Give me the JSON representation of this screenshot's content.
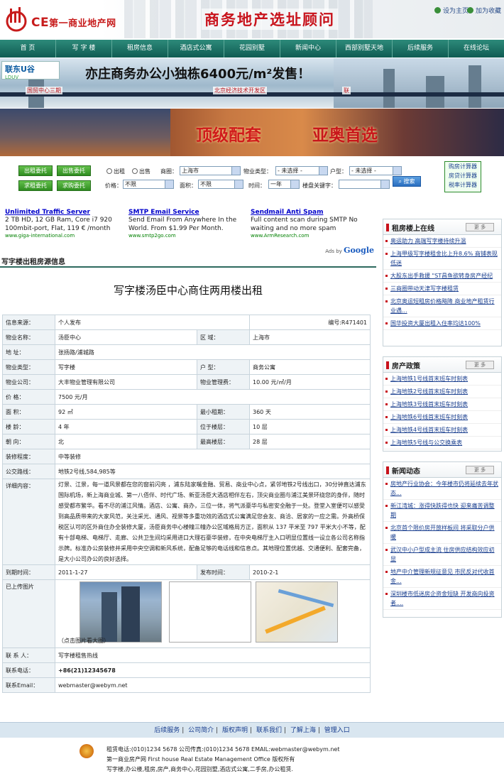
{
  "header": {
    "logo": "CE",
    "logo_text": "第一商业地产网",
    "slogan": "商务地产选址顾问",
    "set_home": "设为主页",
    "add_fav": "加为收藏"
  },
  "nav": [
    "首 页",
    "写 字 楼",
    "租房信息",
    "酒店式公寓",
    "花园别墅",
    "新闻中心",
    "西部别墅天地",
    "后续服务",
    "在线论坛"
  ],
  "banner1": {
    "brand": "联东U谷",
    "brand_sub": "LDUV",
    "headline": "亦庄商务办公小独栋6400元/m²发售！",
    "left_tag": "国贸中心三期",
    "mid_tag": "北京经济技术开发区",
    "right_tag": "联"
  },
  "banner2": {
    "t1": "顶级配套",
    "t2": "亚奥首选"
  },
  "search": {
    "btns": [
      "出租委托",
      "出售委托",
      "求租委托",
      "求购委托"
    ],
    "radio1": "出租",
    "radio2": "出售",
    "shangquan_label": "商圈：",
    "shangquan": "上海市",
    "wuye_label": "物业类型：",
    "wuye": "- 未选择 -",
    "huxing_label": "户型：",
    "huxing": "- 未选择 -",
    "price_label": "价格：",
    "price": "不限",
    "area_label": "面积：",
    "area": "不限",
    "time_label": "时间：",
    "time": "一年",
    "kw_label": "楼盘关键字：",
    "submit": "搜索"
  },
  "calc": [
    "购房计算器",
    "房贷计算器",
    "税率计算器"
  ],
  "ads": [
    {
      "title": "Unlimited Traffic Server",
      "desc": "2 TB HD, 12 GB Ram, Core i7 920 100mbit-port, Flat, 119 € /month",
      "url": "www.giga-international.com"
    },
    {
      "title": "SMTP Email Service",
      "desc": "Send Email From Anywhere In the World. From $1.99 Per Month.",
      "url": "www.smtp2go.com"
    },
    {
      "title": "Sendmail Anti Spam",
      "desc": "Full content scan during SMTP No waiting and no more spam",
      "url": "www.ArmResearch.com"
    }
  ],
  "ads_by": "Ads by",
  "google": "Google",
  "section_title": "写字楼出租房源信息",
  "listing_title": "写字楼汤臣中心商住两用楼出租",
  "table": {
    "source_l": "信息来源：",
    "source": "个人发布",
    "code": "编号:R471401",
    "name_l": "物业名称：",
    "name": "汤臣中心",
    "district_l": "区 域：",
    "district": "上海市",
    "addr_l": "地 址：",
    "addr": "张扬路/浦城路",
    "type_l": "物业类型：",
    "type": "写字楼",
    "huxing_l": "户 型：",
    "huxing": "商务公寓",
    "company_l": "物业公司：",
    "company": "大丰物业管理有限公司",
    "fee_l": "物业管理费：",
    "fee": "10.00 元/㎡/月",
    "price_l": "价 格：",
    "price": "7500 元/月",
    "area_l": "面 积：",
    "area": "92 ㎡",
    "minlease_l": "最小租期：",
    "minlease": "360 天",
    "age_l": "楼 龄：",
    "age": "4 年",
    "floor_l": "位于楼层：",
    "floor": "10 层",
    "face_l": "朝 向：",
    "face": "北",
    "top_l": "最高楼层：",
    "top": "28 层",
    "deco_l": "装修程度：",
    "deco": "中等装修",
    "bus_l": "公交路线：",
    "bus": "地铁2号线,584,985等",
    "detail_l": "详细内容：",
    "detail": "灯景、江景，每一道风景都在您的窗前闪亮 ，浦东陆家嘴金融、贸易、商业中心点，紧邻地铁2号线出口，30分钟直达浦东国际机场，新上海商业城、第一八佰伴、时代广场、新亚汤臣大酒店相伴左右，顶尖商业圈与浦江美景环绕您的身伴，随时感受都市繁华。看不尽的浦江风情。酒店、公寓、商办，三位一体，将气派豪华与私密安全融于一处。登堂入室便可以感受到高品质带来的大家风范，关注采光、通风、视景等多重功效的酒店式公寓满足您会友、商洽、居家的一应之需。外高桥保税区认可的区外商住办全装修大厦，汤臣商务中心楼幢三幢办公区域格局方正，面积从 137 平米至 797 平米大小不等，配有十部电梯、电梯厅、走廊、公共卫生间均采用进口大理石豪华装修，在中央电梯厅主入口明显位置线一设立各公司名称指示牌。标准办公房装修并采用中央空调和新风系统，配备足够的电话线和信息点。其地理位置优越、交通便利、配套完备，是大小公司办公的良好选择。",
    "date_l": "到期时间：",
    "date": "2011-1-27",
    "pub_l": "发布时间：",
    "pub": "2010-2-1",
    "pics_l": "已上传图片",
    "pics_hint": "（点击图片看大图）",
    "contact_l": "联 系 人：",
    "contact": "写字楼租售热线",
    "phone_l": "联系电话：",
    "phone": "+86(21)12345678",
    "email_l": "联系Email：",
    "email": "webmaster@webym.net"
  },
  "sidebar": {
    "more": "更 多",
    "rent": {
      "title": "租房楼上在线",
      "items": [
        "奥运助力 高端写字楼持续升温",
        "上海甲级写字楼租金比上升8.6% 商铺表现低迷",
        "大股东出手救援 \"ST昌鱼欲转身房产经纪",
        "三商圈带动天津写字楼租赁",
        "北京奥运短租房价格飚降 商业地产租赁行业遇...",
        "国华投资大厦出租入住率均达100%"
      ]
    },
    "policy": {
      "title": "房产政策",
      "items": [
        "上海地铁1号线首末班车时刻表",
        "上海地铁2号线首末班车时刻表",
        "上海地铁3号线首末班车时刻表",
        "上海地铁6号线首末班车时刻表",
        "上海地铁4号线首末班车时刻表",
        "上海地铁5号线与公交换乘表"
      ]
    },
    "news": {
      "title": "新闻动态",
      "items": [
        "房地产行业协会：今年楼市仍将延续去年状态...",
        "新江湾城：涨得快跌得也快 迎来痛苦调整期",
        "北京首个限价房开放样板间 将采取分户供暖",
        "武汉中小户型成主流 住房供应结构效应初显",
        "地产中介管理新规征意见 市民反对代收首金...",
        "深圳楼市低迷房企资金短缺 开发商向投资者...."
      ]
    }
  },
  "footer": {
    "links": [
      "后续服务",
      "公司简介",
      "版权声明",
      "联系我们",
      "了解上海",
      "管理入口"
    ],
    "line1": "租赁电话:(010)1234 5678 公司传真:(010)1234 5678 EMAIL:webmaster@webym.net",
    "line2": "第一商业房产网  First house Real Estate Management Office 版权所有",
    "line3": "写字楼,办公楼,租房,房产,商务中心,花园别墅,酒店式公寓,二手房,办公租赁."
  }
}
